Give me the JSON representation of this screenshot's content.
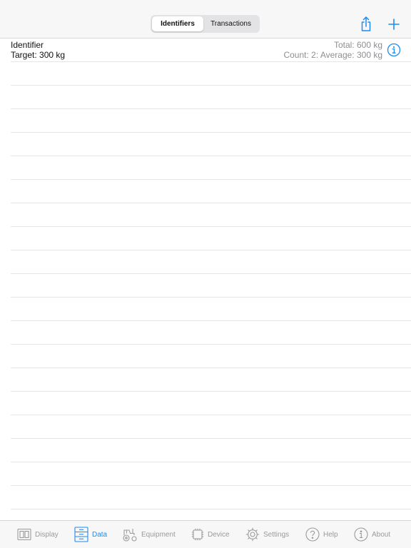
{
  "navbar": {
    "segments": [
      {
        "label": "Identifiers",
        "selected": true
      },
      {
        "label": "Transactions",
        "selected": false
      }
    ],
    "actions": {
      "share_icon": "share-icon",
      "add_icon": "plus-icon"
    }
  },
  "summary": {
    "title": "Identifier",
    "target": "Target: 300 kg",
    "total": "Total: 600 kg",
    "stats": "Count: 2: Average: 300 kg",
    "info_icon": "info-icon"
  },
  "tabbar": {
    "items": [
      {
        "label": "Display",
        "icon": "display-icon",
        "active": false
      },
      {
        "label": "Data",
        "icon": "data-icon",
        "active": true
      },
      {
        "label": "Equipment",
        "icon": "equipment-icon",
        "active": false
      },
      {
        "label": "Device",
        "icon": "device-icon",
        "active": false
      },
      {
        "label": "Settings",
        "icon": "settings-icon",
        "active": false
      },
      {
        "label": "Help",
        "icon": "help-icon",
        "active": false
      },
      {
        "label": "About",
        "icon": "about-icon",
        "active": false
      }
    ]
  },
  "colors": {
    "accent": "#1d8bf1",
    "inactive": "#9a9a9a",
    "secondary_text": "#8e8e93",
    "rule": "#e6e6e6"
  }
}
